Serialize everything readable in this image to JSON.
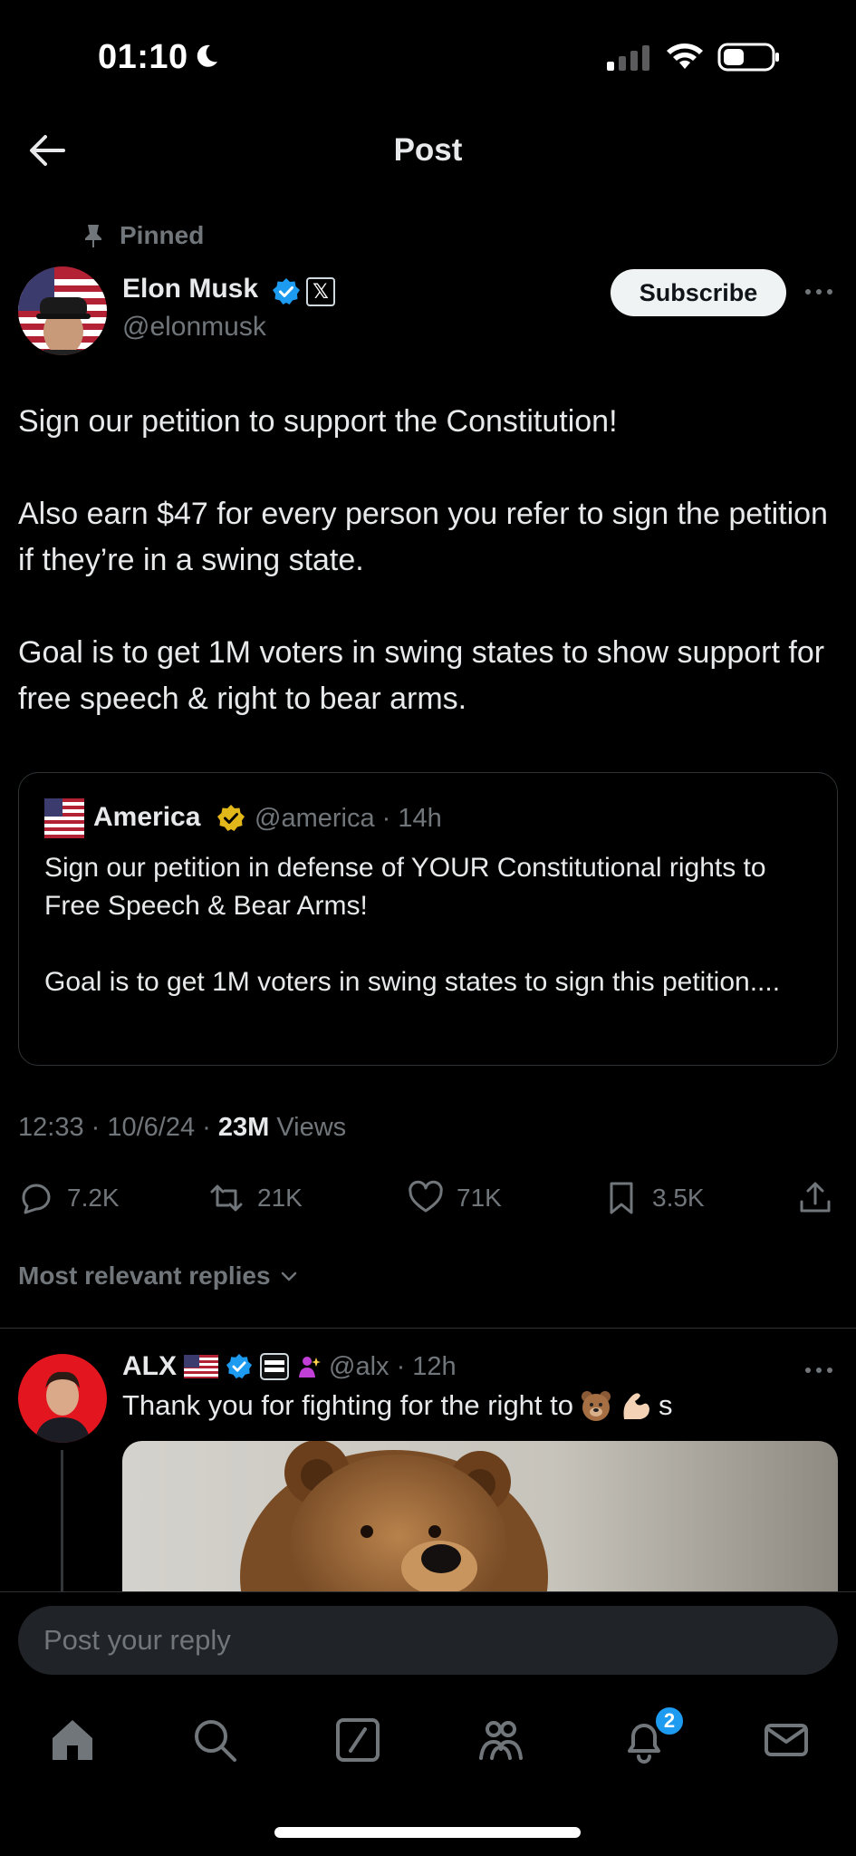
{
  "status_bar": {
    "time": "01:10"
  },
  "header": {
    "title": "Post"
  },
  "post": {
    "pinned_label": "Pinned",
    "author_name": "Elon Musk",
    "author_handle": "@elonmusk",
    "subscribe_label": "Subscribe",
    "paragraphs": [
      "Sign our petition to support the Constitution!",
      "Also earn $47 for every person you refer to sign the petition if they’re in a swing state.",
      "Goal is to get 1M voters in swing states to show support for free speech & right to bear arms."
    ],
    "quote": {
      "name": "America",
      "meta": "@america · 14h",
      "paragraphs": [
        "Sign our petition in defense of YOUR Constitutional rights to Free Speech & Bear Arms!",
        "Goal is to get 1M voters in swing states to sign this petition...."
      ]
    },
    "timestamp": "12:33 · 10/6/24 · ",
    "views_count": "23M",
    "views_label": " Views",
    "actions": {
      "replies": "7.2K",
      "reposts": "21K",
      "likes": "71K",
      "bookmarks": "3.5K"
    }
  },
  "replies_sort_label": "Most relevant replies",
  "reply": {
    "name": "ALX",
    "meta": "@alx · 12h",
    "text": "Thank you for fighting for the right to",
    "text_suffix": "s"
  },
  "composer": {
    "placeholder": "Post your reply"
  },
  "tab_bar": {
    "notifications_badge": "2"
  },
  "colors": {
    "background": "#000000",
    "text_primary": "#e7e9ea",
    "text_secondary": "#71767b",
    "accent_blue": "#1d9bf0",
    "gold_verified": "#e2b719",
    "border": "#2f3336"
  },
  "icons": [
    "moon-icon",
    "signal-icon",
    "wifi-icon",
    "battery-icon",
    "back-arrow-icon",
    "pin-icon",
    "verified-icon",
    "x-badge-icon",
    "more-icon",
    "flag-icon",
    "reply-icon",
    "repost-icon",
    "like-icon",
    "bookmark-icon",
    "share-icon",
    "chevron-down-icon",
    "home-icon",
    "search-icon",
    "grok-icon",
    "communities-icon",
    "notifications-icon",
    "messages-icon"
  ]
}
